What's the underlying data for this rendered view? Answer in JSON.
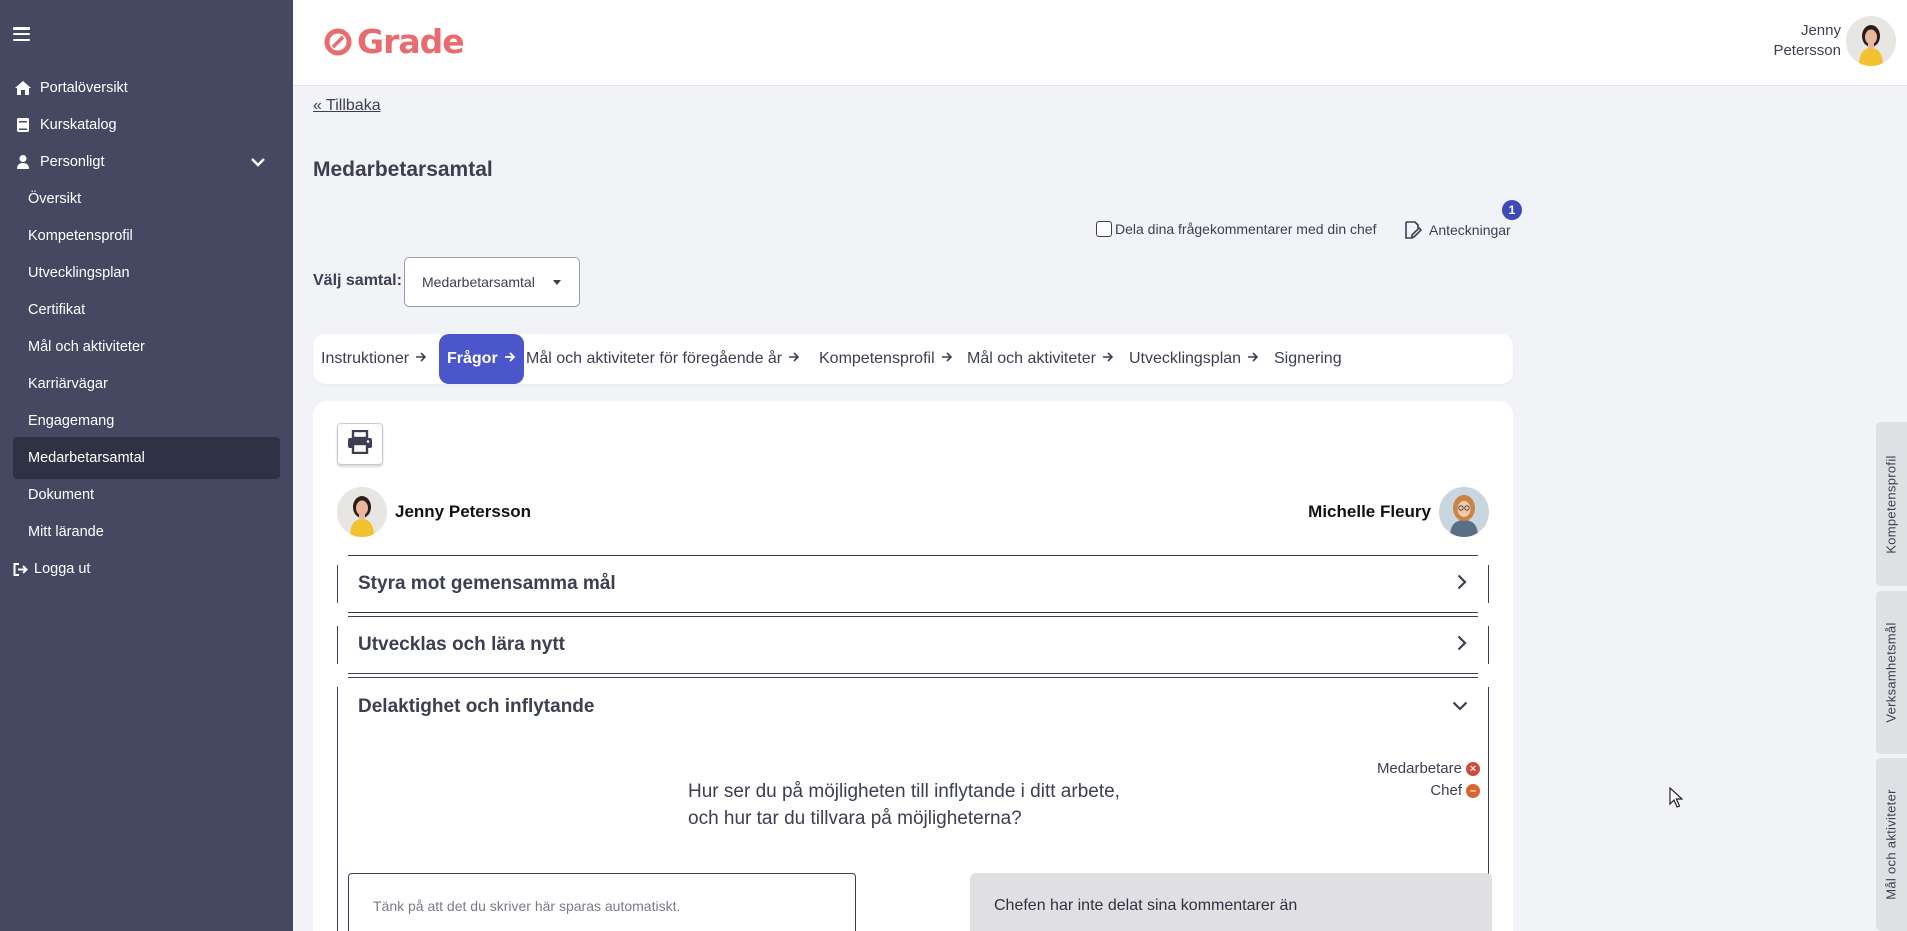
{
  "sidebar": {
    "items": [
      {
        "label": "Portalöversikt",
        "icon": "home-icon"
      },
      {
        "label": "Kurskatalog",
        "icon": "book-icon"
      },
      {
        "label": "Personligt",
        "icon": "user-icon"
      },
      {
        "label": "Översikt"
      },
      {
        "label": "Kompetensprofil"
      },
      {
        "label": "Utvecklingsplan"
      },
      {
        "label": "Certifikat"
      },
      {
        "label": "Mål och aktiviteter"
      },
      {
        "label": "Karriärvägar"
      },
      {
        "label": "Engagemang"
      },
      {
        "label": "Medarbetarsamtal",
        "active": true
      },
      {
        "label": "Dokument"
      },
      {
        "label": "Mitt lärande"
      },
      {
        "label": "Logga ut",
        "icon": "logout-icon"
      }
    ]
  },
  "header": {
    "logo_text": "Grade",
    "user_first": "Jenny",
    "user_last": "Petersson",
    "brand_color": "#ea6b6f"
  },
  "main": {
    "back_link": "« Tillbaka",
    "title": "Medarbetarsamtal",
    "share_label": "Dela dina frågekommentarer med din chef",
    "notes_label": "Anteckningar",
    "notes_count": "1",
    "select_label": "Välj samtal:",
    "select_value": "Medarbetarsamtal",
    "steps": [
      "Instruktioner",
      "Frågor",
      "Mål och aktiviteter för föregående år",
      "Kompetensprofil",
      "Mål och aktiviteter",
      "Utvecklingsplan",
      "Signering"
    ],
    "active_step": "Frågor",
    "employee_name": "Jenny Petersson",
    "manager_name": "Michelle Fleury",
    "sections": [
      {
        "title": "Styra mot gemensamma mål",
        "expanded": false
      },
      {
        "title": "Utvecklas och lära nytt",
        "expanded": false
      },
      {
        "title": "Delaktighet och inflytande",
        "expanded": true
      }
    ],
    "legend": {
      "employee": "Medarbetare",
      "manager": "Chef"
    },
    "question_line1": "Hur ser du på möjligheten till inflytande i ditt arbete,",
    "question_line2": "och hur tar du tillvara på möjligheterna?",
    "textarea_placeholder": "Tänk på att det du skriver här sparas automatiskt.",
    "manager_comment": "Chefen har inte delat sina kommentarer än"
  },
  "side_tabs": [
    "Kompetensprofil",
    "Verksamhetsmål",
    "Mål och aktiviteter"
  ],
  "accent_color": "#4a56c9"
}
